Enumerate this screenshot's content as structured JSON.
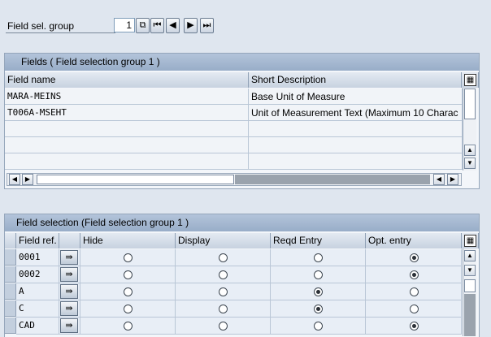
{
  "field_sel_group": {
    "label": "Field sel. group",
    "value": "1"
  },
  "nav": {
    "choose_icon": "pick-icon",
    "first": "first-page-icon",
    "prev": "prev-page-icon",
    "next": "next-page-icon",
    "last": "last-page-icon"
  },
  "fields_panel": {
    "title": "Fields  ( Field selection group   1 )",
    "columns": [
      "Field name",
      "Short Description"
    ],
    "rows": [
      {
        "field": "MARA-MEINS",
        "desc": "Base Unit of Measure"
      },
      {
        "field": "T006A-MSEHT",
        "desc": "Unit of Measurement Text (Maximum 10 Charac"
      },
      {
        "field": "",
        "desc": ""
      },
      {
        "field": "",
        "desc": ""
      },
      {
        "field": "",
        "desc": ""
      }
    ]
  },
  "selection_panel": {
    "title": "Field selection (Field selection group   1 )",
    "columns": [
      "Field ref.",
      "",
      "Hide",
      "Display",
      "Reqd Entry",
      "Opt. entry"
    ],
    "rows": [
      {
        "ref": "0001",
        "choice": "Opt. entry"
      },
      {
        "ref": "0002",
        "choice": "Opt. entry"
      },
      {
        "ref": "A",
        "choice": "Reqd Entry"
      },
      {
        "ref": "C",
        "choice": "Reqd Entry"
      },
      {
        "ref": "CAD",
        "choice": "Opt. entry"
      }
    ]
  },
  "colors": {
    "title_bar": "#a8bbd3",
    "background": "#dfe6ef",
    "row": "#f1f4f8"
  }
}
